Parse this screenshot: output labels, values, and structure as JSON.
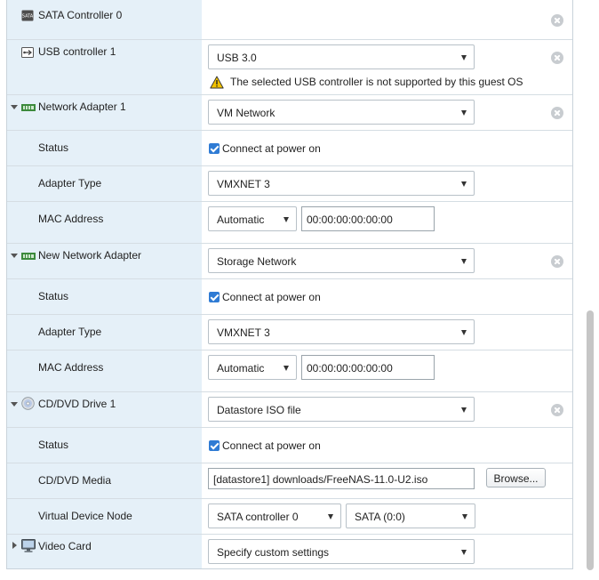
{
  "devices": {
    "sata_controller": {
      "label": "SATA Controller 0",
      "icon_text": "SATA"
    },
    "usb_controller": {
      "label": "USB controller 1",
      "value": "USB 3.0",
      "warning": "The selected USB controller is not supported by this guest OS"
    },
    "network_adapter_1": {
      "label": "Network Adapter 1",
      "value": "VM Network",
      "status_label": "Status",
      "connect_label": "Connect at power on",
      "adapter_type_label": "Adapter Type",
      "adapter_type": "VMXNET 3",
      "mac_label": "MAC Address",
      "mac_mode": "Automatic",
      "mac_value": "00:00:00:00:00:00"
    },
    "new_network_adapter": {
      "label": "New Network Adapter",
      "value": "Storage Network",
      "status_label": "Status",
      "connect_label": "Connect at power on",
      "adapter_type_label": "Adapter Type",
      "adapter_type": "VMXNET 3",
      "mac_label": "MAC Address",
      "mac_mode": "Automatic",
      "mac_value": "00:00:00:00:00:00"
    },
    "cd_dvd_drive": {
      "label": "CD/DVD Drive 1",
      "value": "Datastore ISO file",
      "status_label": "Status",
      "connect_label": "Connect at power on",
      "media_label": "CD/DVD Media",
      "media_value": "[datastore1] downloads/FreeNAS-11.0-U2.iso",
      "browse_label": "Browse...",
      "node_label": "Virtual Device Node",
      "node_controller": "SATA controller 0",
      "node_slot": "SATA (0:0)"
    },
    "video_card": {
      "label": "Video Card",
      "value": "Specify custom settings"
    }
  },
  "colors": {
    "label_column_bg": "#e5f0f8",
    "checkbox_blue": "#2f7bd4",
    "warning_yellow": "#f2c200",
    "nic_green": "#3c8a3c"
  }
}
